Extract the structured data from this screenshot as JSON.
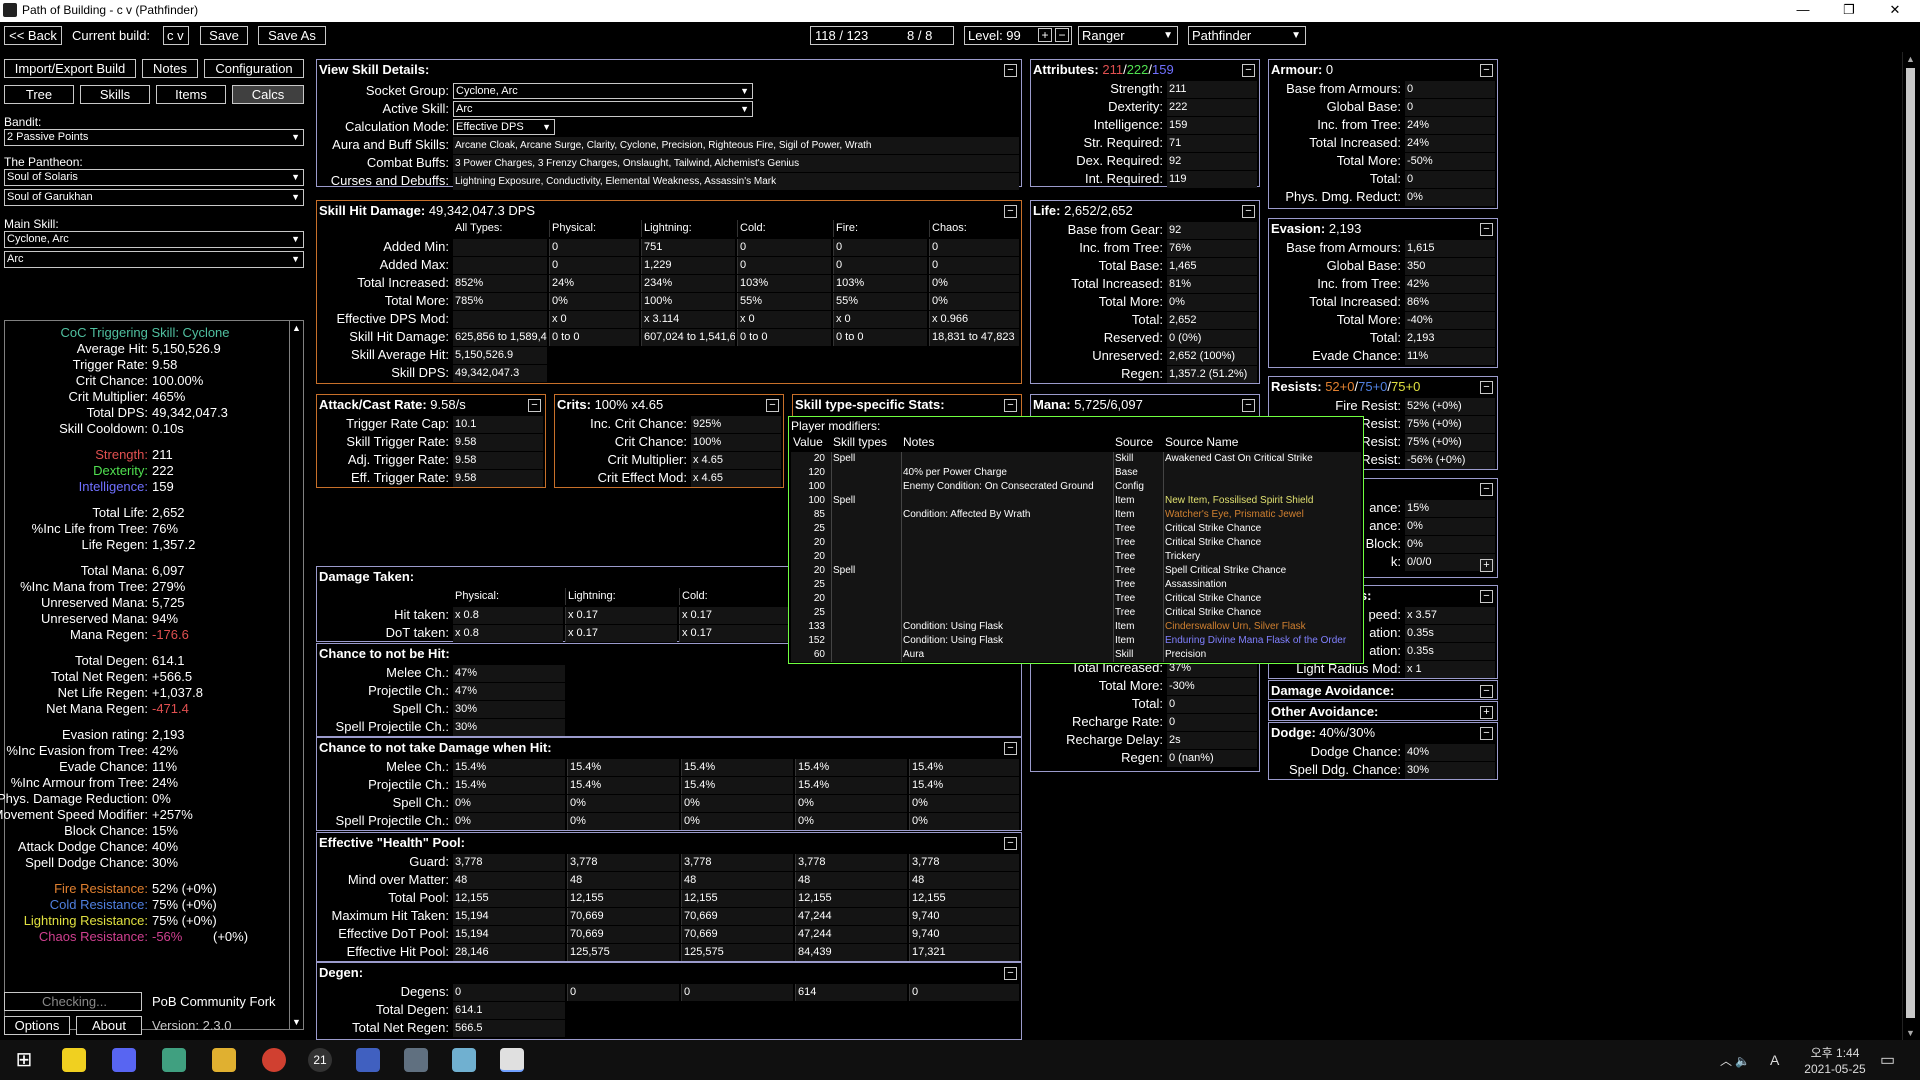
{
  "window": {
    "title": "Path of Building - c v  (Pathfinder)",
    "min": "—",
    "max": "❐",
    "close": "✕"
  },
  "topbar": {
    "back": "<< Back",
    "current_build_label": "Current build:",
    "build_name": "c v",
    "save": "Save",
    "save_as": "Save As",
    "points": "118 / 123",
    "ascend": "8 / 8",
    "level_label": "Level: 99",
    "class": "Ranger",
    "ascendancy": "Pathfinder",
    "plus": "+",
    "minus": "−"
  },
  "left": {
    "tabs": {
      "import": "Import/Export Build",
      "notes": "Notes",
      "config": "Configuration",
      "tree": "Tree",
      "skills": "Skills",
      "items": "Items",
      "calcs": "Calcs"
    },
    "bandit_label": "Bandit:",
    "bandit": "2 Passive Points",
    "pantheon_label": "The Pantheon:",
    "pantheon_major": "Soul of Solaris",
    "pantheon_minor": "Soul of Garukhan",
    "main_skill_label": "Main Skill:",
    "main_skill": "Cyclone, Arc",
    "main_skill_part": "Arc",
    "coc_line": "CoC Triggering Skill: Cyclone",
    "stats": [
      {
        "k": "Average Hit:",
        "v": "5,150,526.9"
      },
      {
        "k": "Trigger Rate:",
        "v": "9.58"
      },
      {
        "k": "Crit Chance:",
        "v": "100.00%"
      },
      {
        "k": "Crit Multiplier:",
        "v": "465%"
      },
      {
        "k": "Total DPS:",
        "v": "49,342,047.3"
      },
      {
        "k": "Skill Cooldown:",
        "v": "0.10s"
      }
    ],
    "attrs": [
      {
        "k": "Strength:",
        "v": "211",
        "c": "#e05050"
      },
      {
        "k": "Dexterity:",
        "v": "222",
        "c": "#50e050"
      },
      {
        "k": "Intelligence:",
        "v": "159",
        "c": "#7070ff"
      }
    ],
    "stats2": [
      {
        "k": "Total Life:",
        "v": "2,652"
      },
      {
        "k": "%Inc Life from Tree:",
        "v": "76%"
      },
      {
        "k": "Life Regen:",
        "v": "1,357.2"
      }
    ],
    "stats3": [
      {
        "k": "Total Mana:",
        "v": "6,097"
      },
      {
        "k": "%Inc Mana from Tree:",
        "v": "279%"
      },
      {
        "k": "Unreserved Mana:",
        "v": "5,725"
      },
      {
        "k": "Unreserved Mana:",
        "v": "94%"
      },
      {
        "k": "Mana Regen:",
        "v": "-176.6",
        "vc": "#e05050"
      }
    ],
    "stats4": [
      {
        "k": "Total Degen:",
        "v": "614.1"
      },
      {
        "k": "Total Net Regen:",
        "v": "+566.5"
      },
      {
        "k": "Net Life Regen:",
        "v": "+1,037.8"
      },
      {
        "k": "Net Mana Regen:",
        "v": "-471.4",
        "vc": "#e05050"
      }
    ],
    "stats5": [
      {
        "k": "Evasion rating:",
        "v": "2,193"
      },
      {
        "k": "%Inc Evasion from Tree:",
        "v": "42%"
      },
      {
        "k": "Evade Chance:",
        "v": "11%"
      },
      {
        "k": "%Inc Armour from Tree:",
        "v": "24%"
      },
      {
        "k": "Phys. Damage Reduction:",
        "v": "0%"
      },
      {
        "k": "Movement Speed Modifier:",
        "v": "+257%"
      },
      {
        "k": "Block Chance:",
        "v": "15%"
      },
      {
        "k": "Attack Dodge Chance:",
        "v": "40%"
      },
      {
        "k": "Spell Dodge Chance:",
        "v": "30%"
      }
    ],
    "res": [
      {
        "k": "Fire Resistance:",
        "v": "52% (+0%)",
        "c": "#e08030"
      },
      {
        "k": "Cold Resistance:",
        "v": "75% (+0%)",
        "c": "#5080e0"
      },
      {
        "k": "Lightning Resistance:",
        "v": "75% (+0%)",
        "c": "#e0e040"
      },
      {
        "k": "Chaos Resistance:",
        "v": "-56%",
        "v2": "(+0%)",
        "c": "#d04090"
      }
    ],
    "checking": "Checking...",
    "fork": "PoB Community Fork",
    "options": "Options",
    "about": "About",
    "version": "Version: 2.3.0"
  },
  "skill_details": {
    "title": "View Skill Details:",
    "rows": [
      {
        "k": "Socket Group:",
        "v": "Cyclone, Arc",
        "dd": true
      },
      {
        "k": "Active Skill:",
        "v": "Arc",
        "dd": true
      },
      {
        "k": "Calculation Mode:",
        "v": "Effective DPS",
        "dd": true
      },
      {
        "k": "Aura and Buff Skills:",
        "v": "Arcane Cloak, Arcane Surge, Clarity, Cyclone, Precision, Righteous Fire, Sigil of Power, Wrath"
      },
      {
        "k": "Combat Buffs:",
        "v": "3 Power Charges, 3 Frenzy Charges, Onslaught, Tailwind, Alchemist's Genius"
      },
      {
        "k": "Curses and Debuffs:",
        "v": "Lightning Exposure, Conductivity, Elemental Weakness, Assassin's Mark"
      }
    ]
  },
  "skill_hit": {
    "title": "Skill Hit Damage:",
    "title_val": "49,342,047.3 DPS",
    "cols": [
      "All Types:",
      "Physical:",
      "Lightning:",
      "Cold:",
      "Fire:",
      "Chaos:"
    ],
    "rows": [
      {
        "k": "Added Min:",
        "v": [
          "",
          "0",
          "751",
          "0",
          "0",
          "0"
        ]
      },
      {
        "k": "Added Max:",
        "v": [
          "",
          "0",
          "1,229",
          "0",
          "0",
          "0"
        ]
      },
      {
        "k": "Total Increased:",
        "v": [
          "852%",
          "24%",
          "234%",
          "103%",
          "103%",
          "0%"
        ]
      },
      {
        "k": "Total More:",
        "v": [
          "785%",
          "0%",
          "100%",
          "55%",
          "55%",
          "0%"
        ]
      },
      {
        "k": "Effective DPS Mod:",
        "v": [
          "",
          "x 0",
          "x 3.114",
          "x 0",
          "x 0",
          "x 0.966"
        ]
      },
      {
        "k": "Skill Hit Damage:",
        "v": [
          "625,856 to 1,589,4",
          "0 to 0",
          "607,024 to 1,541,6",
          "0 to 0",
          "0 to 0",
          "18,831 to 47,823"
        ]
      },
      {
        "k": "Skill Average Hit:",
        "v": [
          "5,150,526.9"
        ]
      },
      {
        "k": "Skill DPS:",
        "v": [
          "49,342,047.3"
        ]
      }
    ]
  },
  "attack_rate": {
    "title": "Attack/Cast Rate:",
    "title_val": "9.58/s",
    "rows": [
      {
        "k": "Trigger Rate Cap:",
        "v": "10.1"
      },
      {
        "k": "Skill Trigger Rate:",
        "v": "9.58"
      },
      {
        "k": "Adj. Trigger Rate:",
        "v": "9.58"
      },
      {
        "k": "Eff. Trigger Rate:",
        "v": "9.58"
      }
    ]
  },
  "crits": {
    "title": "Crits:",
    "title_val": "100% x4.65",
    "rows": [
      {
        "k": "Inc. Crit Chance:",
        "v": "925%"
      },
      {
        "k": "Crit Chance:",
        "v": "100%"
      },
      {
        "k": "Crit Multiplier:",
        "v": "x 4.65"
      },
      {
        "k": "Crit Effect Mod:",
        "v": "x 4.65"
      }
    ]
  },
  "skill_type": {
    "title": "Skill type-specific Stats:"
  },
  "damage_taken": {
    "title": "Damage Taken:",
    "cols": [
      "Physical:",
      "Lightning:",
      "Cold:"
    ],
    "rows": [
      {
        "k": "Hit taken:",
        "v": [
          "x 0.8",
          "x 0.17",
          "x 0.17"
        ]
      },
      {
        "k": "DoT taken:",
        "v": [
          "x 0.8",
          "x 0.17",
          "x 0.17"
        ]
      }
    ]
  },
  "not_hit": {
    "title": "Chance to not be Hit:",
    "rows": [
      {
        "k": "Melee Ch.:",
        "v": "47%"
      },
      {
        "k": "Projectile Ch.:",
        "v": "47%"
      },
      {
        "k": "Spell Ch.:",
        "v": "30%"
      },
      {
        "k": "Spell Projectile Ch.:",
        "v": "30%"
      }
    ]
  },
  "not_damage": {
    "title": "Chance to not take Damage when Hit:",
    "rows": [
      {
        "k": "Melee Ch.:",
        "v": [
          "15.4%",
          "15.4%",
          "15.4%",
          "15.4%",
          "15.4%"
        ]
      },
      {
        "k": "Projectile Ch.:",
        "v": [
          "15.4%",
          "15.4%",
          "15.4%",
          "15.4%",
          "15.4%"
        ]
      },
      {
        "k": "Spell Ch.:",
        "v": [
          "0%",
          "0%",
          "0%",
          "0%",
          "0%"
        ]
      },
      {
        "k": "Spell Projectile Ch.:",
        "v": [
          "0%",
          "0%",
          "0%",
          "0%",
          "0%"
        ]
      }
    ]
  },
  "ehp": {
    "title": "Effective \"Health\" Pool:",
    "rows": [
      {
        "k": "Guard:",
        "v": [
          "3,778",
          "3,778",
          "3,778",
          "3,778",
          "3,778"
        ]
      },
      {
        "k": "Mind over Matter:",
        "v": [
          "48",
          "48",
          "48",
          "48",
          "48"
        ]
      },
      {
        "k": "Total Pool:",
        "v": [
          "12,155",
          "12,155",
          "12,155",
          "12,155",
          "12,155"
        ]
      },
      {
        "k": "Maximum Hit Taken:",
        "v": [
          "15,194",
          "70,669",
          "70,669",
          "47,244",
          "9,740"
        ]
      },
      {
        "k": "Effective DoT Pool:",
        "v": [
          "15,194",
          "70,669",
          "70,669",
          "47,244",
          "9,740"
        ]
      },
      {
        "k": "Effective Hit Pool:",
        "v": [
          "28,146",
          "125,575",
          "125,575",
          "84,439",
          "17,321"
        ]
      }
    ]
  },
  "degen": {
    "title": "Degen:",
    "rows": [
      {
        "k": "Degens:",
        "v": [
          "0",
          "0",
          "0",
          "614",
          "0"
        ]
      },
      {
        "k": "Total Degen:",
        "v": [
          "614.1"
        ]
      },
      {
        "k": "Total Net Regen:",
        "v": [
          "566.5"
        ]
      }
    ]
  },
  "attributes": {
    "title": "Attributes:",
    "t1": "211",
    "t2": "222",
    "t3": "159",
    "rows": [
      {
        "k": "Strength:",
        "v": "211"
      },
      {
        "k": "Dexterity:",
        "v": "222"
      },
      {
        "k": "Intelligence:",
        "v": "159"
      },
      {
        "k": "Str. Required:",
        "v": "71"
      },
      {
        "k": "Dex. Required:",
        "v": "92"
      },
      {
        "k": "Int. Required:",
        "v": "119"
      }
    ]
  },
  "life": {
    "title": "Life:",
    "title_val": "2,652/2,652",
    "rows": [
      {
        "k": "Base from Gear:",
        "v": "92"
      },
      {
        "k": "Inc. from Tree:",
        "v": "76%"
      },
      {
        "k": "Total Base:",
        "v": "1,465"
      },
      {
        "k": "Total Increased:",
        "v": "81%"
      },
      {
        "k": "Total More:",
        "v": "0%"
      },
      {
        "k": "Total:",
        "v": "2,652"
      },
      {
        "k": "Reserved:",
        "v": "0 (0%)"
      },
      {
        "k": "Unreserved:",
        "v": "2,652 (100%)"
      },
      {
        "k": "Regen:",
        "v": "1,357.2 (51.2%)"
      }
    ]
  },
  "mana": {
    "title": "Mana:",
    "title_val": "5,725/6,097",
    "rows": [
      {
        "k": "Total Increased:",
        "v": "37%"
      },
      {
        "k": "Total More:",
        "v": "-30%"
      },
      {
        "k": "Total:",
        "v": "0"
      },
      {
        "k": "Recharge Rate:",
        "v": "0"
      },
      {
        "k": "Recharge Delay:",
        "v": "2s"
      },
      {
        "k": "Regen:",
        "v": "0 (nan%)"
      }
    ]
  },
  "armour": {
    "title": "Armour:",
    "title_val": "0",
    "rows": [
      {
        "k": "Base from Armours:",
        "v": "0"
      },
      {
        "k": "Global Base:",
        "v": "0"
      },
      {
        "k": "Inc. from Tree:",
        "v": "24%"
      },
      {
        "k": "Total Increased:",
        "v": "24%"
      },
      {
        "k": "Total More:",
        "v": "-50%"
      },
      {
        "k": "Total:",
        "v": "0"
      },
      {
        "k": "Phys. Dmg. Reduct:",
        "v": "0%"
      }
    ]
  },
  "evasion": {
    "title": "Evasion:",
    "title_val": "2,193",
    "rows": [
      {
        "k": "Base from Armours:",
        "v": "1,615"
      },
      {
        "k": "Global Base:",
        "v": "350"
      },
      {
        "k": "Inc. from Tree:",
        "v": "42%"
      },
      {
        "k": "Total Increased:",
        "v": "86%"
      },
      {
        "k": "Total More:",
        "v": "-40%"
      },
      {
        "k": "Total:",
        "v": "2,193"
      },
      {
        "k": "Evade Chance:",
        "v": "11%"
      }
    ]
  },
  "resists": {
    "title": "Resists:",
    "t1": "52+0",
    "t2": "75+0",
    "t3": "75+0",
    "rows": [
      {
        "k": "Fire Resist:",
        "v": "52% (+0%)"
      },
      {
        "k": "Cold Resist:",
        "v": "75% (+0%)"
      },
      {
        "k": "Lightning Resist:",
        "v": "75% (+0%)"
      },
      {
        "k": "Chaos Resist:",
        "v": "-56% (+0%)"
      }
    ]
  },
  "block": {
    "rows": [
      {
        "k": "ance:",
        "v": "15%"
      },
      {
        "k": "ance:",
        "v": "0%"
      },
      {
        "k": "Block:",
        "v": "0%"
      },
      {
        "k": "k:",
        "v": "0/0/0"
      }
    ]
  },
  "other_def": {
    "title": "Other Defences:",
    "rows": [
      {
        "k": "peed:",
        "v": "x 3.57"
      },
      {
        "k": "ation:",
        "v": "0.35s"
      },
      {
        "k": "ation:",
        "v": "0.35s"
      },
      {
        "k": "Light Radius Mod:",
        "v": "x 1"
      }
    ]
  },
  "dmg_avoid": {
    "title": "Damage Avoidance:"
  },
  "other_avoid": {
    "title": "Other Avoidance:"
  },
  "dodge": {
    "title": "Dodge:",
    "title_val": "40%/30%",
    "rows": [
      {
        "k": "Dodge Chance:",
        "v": "40%"
      },
      {
        "k": "Spell Ddg. Chance:",
        "v": "30%"
      }
    ]
  },
  "tooltip": {
    "title": "Player modifiers:",
    "cols": [
      "Value",
      "Skill types",
      "Notes",
      "Source",
      "Source Name"
    ],
    "rows": [
      {
        "v": "20",
        "s": "Spell",
        "n": "",
        "src": "Skill",
        "name": "Awakened Cast On Critical Strike",
        "c": "#fff"
      },
      {
        "v": "120",
        "s": "",
        "n": "40% per Power Charge",
        "src": "Base",
        "name": "",
        "c": "#fff"
      },
      {
        "v": "100",
        "s": "",
        "n": "Enemy Condition: On Consecrated Ground",
        "src": "Config",
        "name": "",
        "c": "#fff"
      },
      {
        "v": "100",
        "s": "Spell",
        "n": "",
        "src": "Item",
        "name": "New Item, Fossilised Spirit Shield",
        "c": "#e0e070"
      },
      {
        "v": "85",
        "s": "",
        "n": "Condition: Affected By Wrath",
        "src": "Item",
        "name": "Watcher's Eye, Prismatic Jewel",
        "c": "#d08030"
      },
      {
        "v": "25",
        "s": "",
        "n": "",
        "src": "Tree",
        "name": "Critical Strike Chance",
        "c": "#fff"
      },
      {
        "v": "20",
        "s": "",
        "n": "",
        "src": "Tree",
        "name": "Critical Strike Chance",
        "c": "#fff"
      },
      {
        "v": "20",
        "s": "",
        "n": "",
        "src": "Tree",
        "name": "Trickery",
        "c": "#fff"
      },
      {
        "v": "20",
        "s": "Spell",
        "n": "",
        "src": "Tree",
        "name": "Spell Critical Strike Chance",
        "c": "#fff"
      },
      {
        "v": "25",
        "s": "",
        "n": "",
        "src": "Tree",
        "name": "Assassination",
        "c": "#fff"
      },
      {
        "v": "20",
        "s": "",
        "n": "",
        "src": "Tree",
        "name": "Critical Strike Chance",
        "c": "#fff"
      },
      {
        "v": "25",
        "s": "",
        "n": "",
        "src": "Tree",
        "name": "Critical Strike Chance",
        "c": "#fff"
      },
      {
        "v": "133",
        "s": "",
        "n": "Condition: Using Flask",
        "src": "Item",
        "name": "Cinderswallow Urn, Silver Flask",
        "c": "#d08030"
      },
      {
        "v": "152",
        "s": "",
        "n": "Condition: Using Flask",
        "src": "Item",
        "name": "Enduring Divine Mana Flask of the Order",
        "c": "#8080ff"
      },
      {
        "v": "60",
        "s": "",
        "n": "Aura",
        "src": "Skill",
        "name": "Precision",
        "c": "#fff"
      }
    ]
  },
  "taskbar": {
    "time": "오후 1:44",
    "date": "2021-05-25",
    "ime": "A",
    "badge": "21"
  }
}
